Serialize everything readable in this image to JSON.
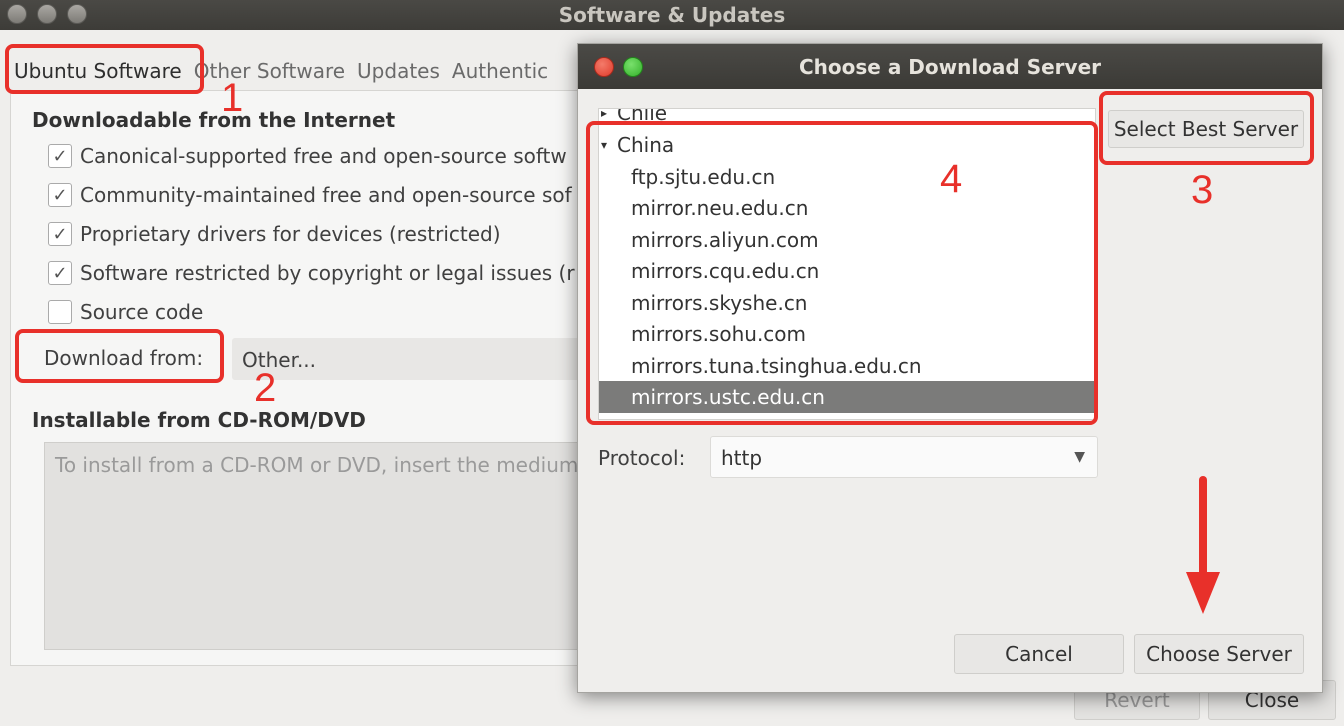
{
  "main_window": {
    "title": "Software & Updates",
    "tabs": [
      "Ubuntu Software",
      "Other Software",
      "Updates",
      "Authentic"
    ],
    "downloadable_title": "Downloadable from the Internet",
    "checkboxes": [
      {
        "label": "Canonical-supported free and open-source softw",
        "checked": true
      },
      {
        "label": "Community-maintained free and open-source sof",
        "checked": true
      },
      {
        "label": "Proprietary drivers for devices (restricted)",
        "checked": true
      },
      {
        "label": "Software restricted by copyright or legal issues (r",
        "checked": true
      },
      {
        "label": "Source code",
        "checked": false
      }
    ],
    "download_from_label": "Download from:",
    "download_from_value": "Other...",
    "installable_title": "Installable from CD-ROM/DVD",
    "cd_hint": "To install from a CD-ROM or DVD, insert the medium",
    "revert_label": "Revert",
    "close_label": "Close"
  },
  "dialog": {
    "title": "Choose a Download Server",
    "partial_top": "Chile",
    "country": "China",
    "servers": [
      "ftp.sjtu.edu.cn",
      "mirror.neu.edu.cn",
      "mirrors.aliyun.com",
      "mirrors.cqu.edu.cn",
      "mirrors.skyshe.cn",
      "mirrors.sohu.com",
      "mirrors.tuna.tsinghua.edu.cn",
      "mirrors.ustc.edu.cn"
    ],
    "selected_server": "mirrors.ustc.edu.cn",
    "select_best_label": "Select Best Server",
    "protocol_label": "Protocol:",
    "protocol_value": "http",
    "cancel_label": "Cancel",
    "choose_label": "Choose Server"
  },
  "annotations": {
    "step1": "1",
    "step2": "2",
    "step3": "3",
    "step4": "4",
    "color": "#e8302a"
  }
}
